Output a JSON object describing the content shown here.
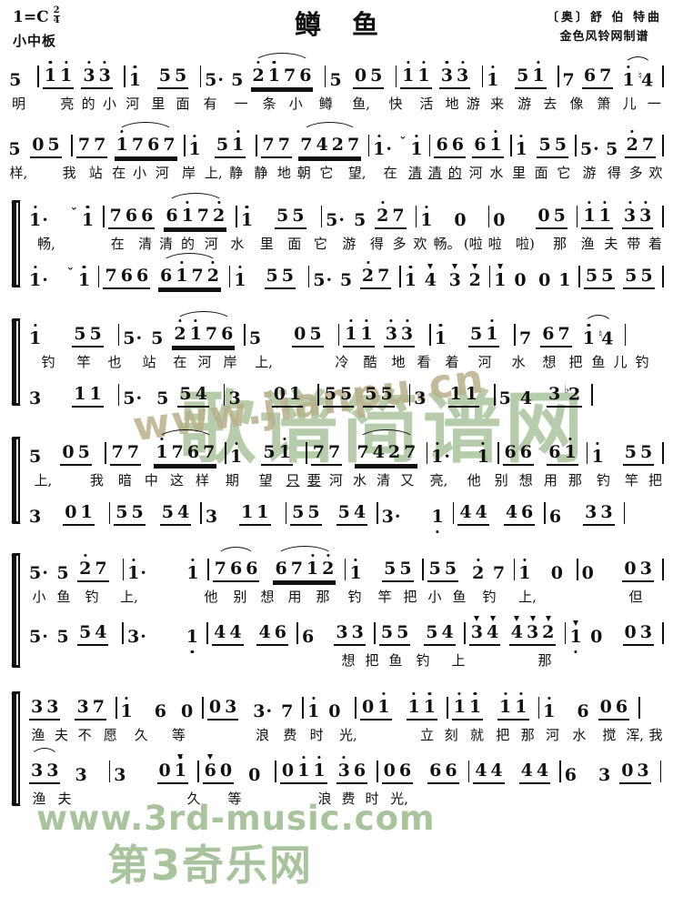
{
  "header": {
    "key": "1=C",
    "time_numerator": "2",
    "time_denominator": "4",
    "tempo": "小中板",
    "title": "鳟鱼",
    "composer": "〔奥〕舒 伯 特曲",
    "transcriber": "金色风铃网制谱"
  },
  "watermarks": {
    "jianpu_url": "www.jianpu.cn",
    "jianpu_name": "歌谱简谱网",
    "third_url": "www.3rd-music.com",
    "third_name": "第3奇乐网",
    "color_green": "#9fbb8e",
    "color_tan": "#b9b08a"
  },
  "score": {
    "systems": [
      {
        "id": "system-1",
        "bracketed": false,
        "voices": [
          {
            "id": "voice-1",
            "notes": "5 | 1̇ 1̇ 3̇ 3̇ | 1̇ 5 5 | 5· 5 2̇ 1̇ 7 6 | 5 0 5 | 1̇ 1̇ 3̇ 3̇ | 1̇ 5 1̇ | 7 6 7 1̇ ♮4 |",
            "lyrics": "明 亮的小河 里 面有 一 条小 鳟 鱼, 快 活地游来 游 去像 箫儿 一"
          }
        ]
      },
      {
        "id": "system-2",
        "bracketed": false,
        "voices": [
          {
            "id": "voice-1",
            "notes": "5 0 5 | 7 7 1̇ 7 6 7 | 1̇ 5 1̇ | 7 7 7 4 2 7 | 1̇· 1̇ | 6 6 6 1̇ | 1̇ 5 5 | 5· 5 2̇ 7 |",
            "lyrics": "样, 我 站在小河 岸 上,静 静地朝它 望, 在 清清的河水 里 面它 游 得多欢"
          }
        ]
      },
      {
        "id": "system-3",
        "bracketed": true,
        "voices": [
          {
            "id": "voice-1",
            "notes": "1̇· 1̇ | 7 6 6 6 1̇ 7 2̇ | 1̇ 5 5 | 5· 5 2̇ 7 | 1̇ 0 | 0 5 | 1̇ 1̇ 3̇ 3̇ |",
            "lyrics": "畅, 在 清清的 河水 里 面它 游 得多欢 畅。(啦啦 啦) 那 渔夫 带着"
          },
          {
            "id": "voice-2",
            "notes": "1̇· 1̇ | 7 6 6 6 1̇ 7 2̇ | 1̇ 5 5 | 5· 5 2̇ 7 | 1̇ 4 3 2 | 1̇ 0 0 1 | 5 5 5 5 |",
            "lyrics": ""
          }
        ]
      },
      {
        "id": "system-4",
        "bracketed": true,
        "voices": [
          {
            "id": "voice-1",
            "notes": "1̇ 5 5 | 5· 5 2̇ 1̇ 7 6 | 5 0 5 | 1̇ 1̇ 3̇ 3̇ | 1̇ 5 1̇ | 7 6 7 1̇ ♮4 |",
            "lyrics": "钓 竿也 站 在河岸 上, 冷 酷地 看着 河 水想 把鱼儿钓"
          },
          {
            "id": "voice-2",
            "notes": "3 1 1 | 5· 5 5 4 | 3 0 1 | 5 5 5 5 | 3 1 1 | 5 4 3 ♮2 |",
            "lyrics": ""
          }
        ]
      },
      {
        "id": "system-5",
        "bracketed": true,
        "voices": [
          {
            "id": "voice-1",
            "notes": "5 0 5 | 7 7 1̇ 7 6 7 | 1̇ 5 1̇ | 7 7 7 4 2 7 | 1̇· 1̇ | 6 6 6 1̇ | 1̇ 5 5 |",
            "lyrics": "上, 我 暗中这样 期 望只要 河水 清又 亮, 他 别想 用那 钓 竿把"
          },
          {
            "id": "voice-2",
            "notes": "3 0 1 | 5 5 5 4 | 3 1 1 | 5 5 5 4 | 3· 1 | 4 4 4 6 | 6 3 3 |",
            "lyrics": ""
          }
        ]
      },
      {
        "id": "system-6",
        "bracketed": true,
        "voices": [
          {
            "id": "voice-1",
            "notes": "5· 5 2̇ 7 | 1̇· 1̇ | 7 6 6 6 7 1̇ 2̇ | 1̇ 5 5 | 5 5 2̇ 7 | 1̇ 0 | 0 0 3 |",
            "lyrics": "小 鱼钓 上, 他 别想用那 钓 竿把 小鱼 钓 上, 但"
          },
          {
            "id": "voice-2",
            "notes": "5· 5 5 4 | 3· 1 | 4 4 4 6 | 6 3 3 | 5 5 5 4 | 3 4 4 3 2 | 1̇ 0 0 3 |",
            "lyrics": "想把鱼钓 上 那"
          }
        ]
      },
      {
        "id": "system-7",
        "bracketed": true,
        "voices": [
          {
            "id": "voice-1",
            "notes": "3 3 3 7 | 1̇ 6 0 | 0 3 3· 7 | 1̇ 0 | 0 1̇ 1̇ 1̇ | 1̇ 1̇ 1̇ 1̇ | 1̇ 6 0 6 |",
            "lyrics": "渔夫 不愿 久 等 浪 费 时 光, 立 刻就 把那 河水 搅 浑,我"
          },
          {
            "id": "voice-2",
            "notes": "3 3 3 | 3 0 1̇ | 6 0 0 | 0 1 1 3 6 | 0 6 6 6 | 4 4 4 4 | 6 3 0 3 |",
            "lyrics": "渔夫 久 等 浪费时光,"
          }
        ]
      }
    ]
  }
}
